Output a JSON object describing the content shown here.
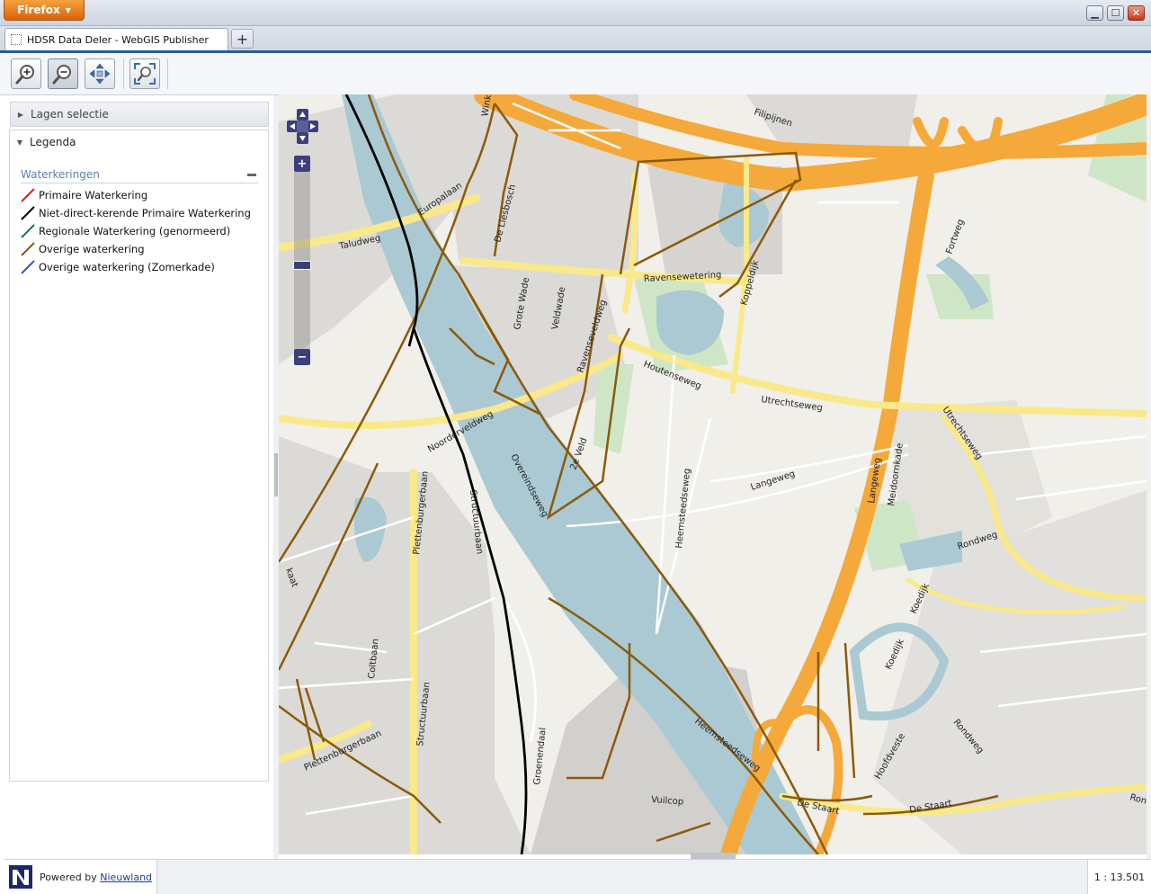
{
  "browser": {
    "app_button": "Firefox",
    "tab_title": "HDSR Data Deler - WebGIS Publisher",
    "new_tab_symbol": "+",
    "minimize": "▁",
    "maximize": "☐",
    "close": "✕"
  },
  "panel": {
    "lagen_title": "Lagen selectie",
    "legenda_title": "Legenda",
    "group_title": "Waterkeringen",
    "legend_items": [
      {
        "label": "Primaire Waterkering",
        "color": "#e02020"
      },
      {
        "label": "Niet-direct-kerende Primaire Waterkering",
        "color": "#000000"
      },
      {
        "label": "Regionale Waterkering (genormeerd)",
        "color": "#0a7a5a"
      },
      {
        "label": "Overige waterkering",
        "color": "#8b5a0a"
      },
      {
        "label": "Overige waterkering (Zomerkade)",
        "color": "#2060d0"
      }
    ]
  },
  "map": {
    "zoom_in": "+",
    "zoom_out": "−",
    "labels": {
      "filipijnen": "Filipijnen",
      "winkel": "Winkel",
      "europalaan": "Europalaan",
      "de_liesbosch": "De Liesbosch",
      "taludweg": "Taludweg",
      "ravensewetering": "Ravensewetering",
      "koppeldijk": "Koppeldijk",
      "fortweg": "Fortweg",
      "grote_wade": "Grote Wade",
      "veldwade": "Veldwade",
      "ravenseveldweg": "Ravenseveldweg",
      "houtenseweg": "Houtenseweg",
      "utrechtseweg": "Utrechtseweg",
      "utrechtseweg2": "Utrechtseweg",
      "noorderveldweg": "Noorderveldweg",
      "overeindseweg": "Overeindseweg",
      "ze_veld": "2e Veld",
      "plettenburgerbaan": "Plettenburgerbaan",
      "structuurbaan": "Structuurbaan",
      "heemsteedseweg": "Heemsteedseweg",
      "langeweg": "Langeweg",
      "langeweg2": "Langeweg",
      "meidoornkade": "Meidoornkade",
      "rondweg": "Rondweg",
      "rondweg2": "Rondweg",
      "rondweg3": "Rond",
      "koedijk": "Koedijk",
      "koedijk2": "Koedijk",
      "coltbaan": "Coltbaan",
      "structuurbaan2": "Structuurbaan",
      "plettenburgerbaan2": "Plettenburgerbaan",
      "groenendaal": "Groenendaal",
      "heemsteedseweg2": "Heemsteedseweg",
      "vuilcop": "Vuilcop",
      "de_staart": "De Staart",
      "de_staart2": "De Staart",
      "hoofdveste": "Hoofdveste",
      "kaat": "kaat"
    }
  },
  "footer": {
    "powered_by": "Powered by ",
    "powered_link": "Nieuwland",
    "scale": "1 : 13.501"
  }
}
